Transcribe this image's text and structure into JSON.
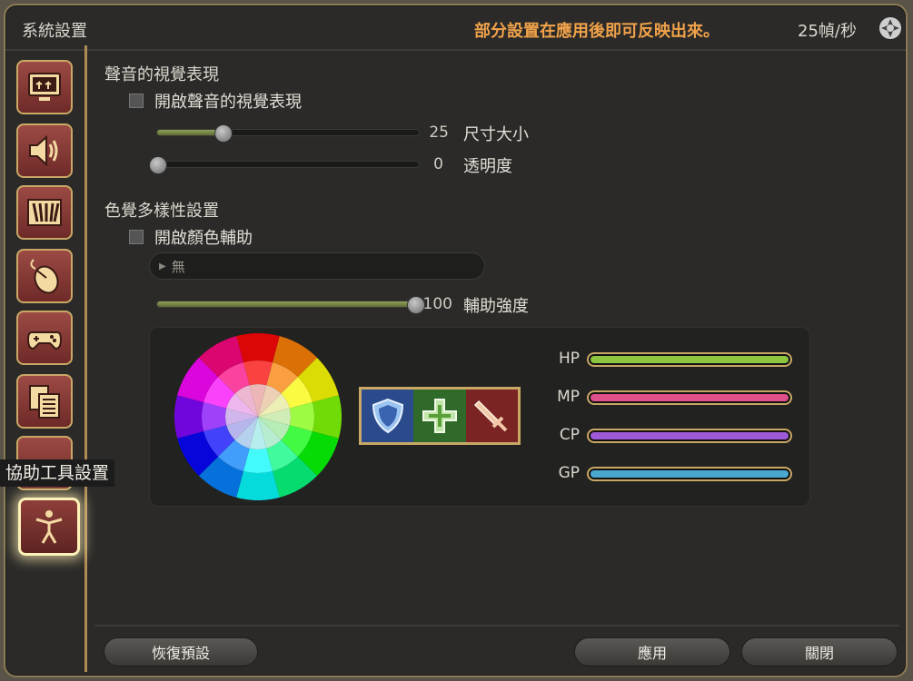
{
  "titlebar": {
    "title": "系統設置",
    "notice": "部分設置在應用後即可反映出來。",
    "fps": "25幀/秒",
    "settings_icon": "gear-icon"
  },
  "sidebar": {
    "items": [
      {
        "icon": "display-upload-icon"
      },
      {
        "icon": "speaker-icon"
      },
      {
        "icon": "hud-bars-icon"
      },
      {
        "icon": "mouse-icon"
      },
      {
        "icon": "gamepad-icon"
      },
      {
        "icon": "documents-icon"
      },
      {
        "icon": "ellipsis-icon"
      },
      {
        "icon": "accessibility-figure-icon",
        "active": true
      }
    ],
    "tooltip": "協助工具設置"
  },
  "sound_visual": {
    "section_title": "聲音的視覺表現",
    "enable_label": "開啟聲音的視覺表現",
    "size": {
      "value": "25",
      "label": "尺寸大小",
      "fraction": 0.25
    },
    "opacity": {
      "value": "0",
      "label": "透明度",
      "fraction": 0.0
    }
  },
  "color_assist": {
    "section_title": "色覺多樣性設置",
    "enable_label": "開啟顏色輔助",
    "dropdown_value": "無",
    "strength": {
      "value": "100",
      "label": "輔助強度",
      "fraction": 1.0
    }
  },
  "preview": {
    "role_icons": [
      "shield-icon",
      "cross-icon",
      "sword-icon"
    ],
    "role_colors": [
      "#2a4a8c",
      "#2f6a2a",
      "#7a2424"
    ],
    "bars": [
      {
        "label": "HP",
        "color": "#8cc63f"
      },
      {
        "label": "MP",
        "color": "#e0508a"
      },
      {
        "label": "CP",
        "color": "#9e5ad6"
      },
      {
        "label": "GP",
        "color": "#4aa8d0"
      }
    ]
  },
  "footer": {
    "reset_label": "恢復預設",
    "apply_label": "應用",
    "close_label": "關閉"
  }
}
